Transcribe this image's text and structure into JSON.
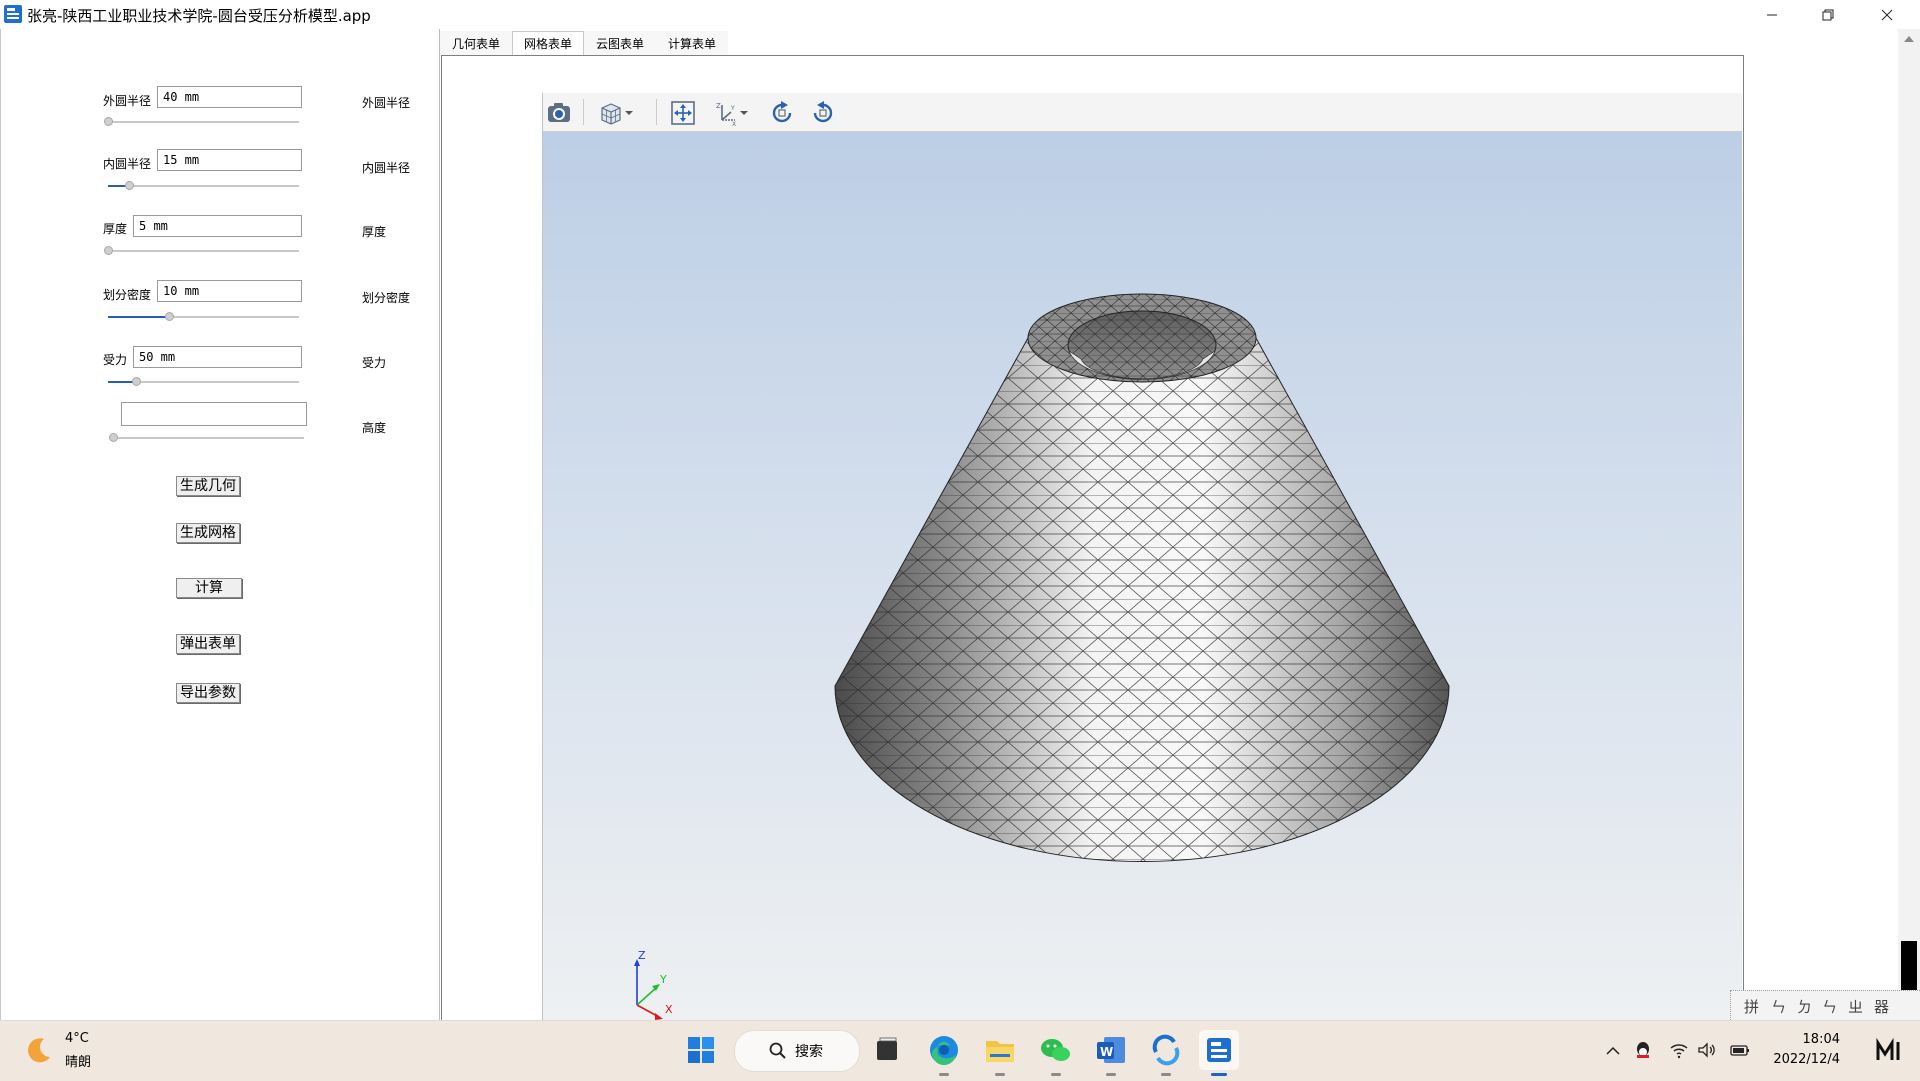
{
  "window": {
    "title": "张亮-陕西工业职业技术学院-圆台受压分析模型.app",
    "buttons": [
      "minimize",
      "restore",
      "close"
    ]
  },
  "tabs": [
    {
      "label": "几何表单",
      "active": false
    },
    {
      "label": "网格表单",
      "active": true
    },
    {
      "label": "云图表单",
      "active": false
    },
    {
      "label": "计算表单",
      "active": false
    }
  ],
  "params": [
    {
      "label": "外圆半径",
      "value": "40 mm",
      "side_label": "外圆半径",
      "slider": 0.0
    },
    {
      "label": "内圆半径",
      "value": "15 mm",
      "side_label": "内圆半径",
      "slider": 0.11
    },
    {
      "label": "厚度",
      "value": "5 mm",
      "side_label": "厚度",
      "slider": 0.0
    },
    {
      "label": "划分密度",
      "value": "10 mm",
      "side_label": "划分密度",
      "slider": 0.33
    },
    {
      "label": "受力",
      "value": "50 mm",
      "side_label": "受力",
      "slider": 0.15
    },
    {
      "label": "",
      "value": "",
      "side_label": "高度",
      "slider": 0.0
    }
  ],
  "actions": [
    "生成几何",
    "生成网格",
    "计算",
    "弹出表单",
    "导出参数"
  ],
  "viewer": {
    "toolbar": [
      "camera-icon",
      "view-cube-icon",
      "fit-view-icon",
      "axes-icon",
      "rotate-cw-icon",
      "rotate-ccw-icon"
    ],
    "triad_labels": {
      "x": "X",
      "y": "Y",
      "z": "Z"
    },
    "triad_colors": {
      "x": "#e0161b",
      "y": "#1fbf2a",
      "z": "#1d40e0"
    },
    "background_top": "#bacde5",
    "background_bottom": "#eef0f2"
  },
  "ime": {
    "chars": [
      "拼",
      "ㄣ",
      "ㄉ",
      "ㄣ",
      "ㄓ",
      "器"
    ]
  },
  "taskbar": {
    "weather": {
      "temp": "4°C",
      "desc": "晴朗"
    },
    "search_label": "搜索",
    "apps": [
      "widgets-icon",
      "edge-icon",
      "file-explorer-icon",
      "wechat-icon",
      "word-icon",
      "sync-icon",
      "app-icon"
    ],
    "time": "18:04",
    "date": "2022/12/4"
  }
}
